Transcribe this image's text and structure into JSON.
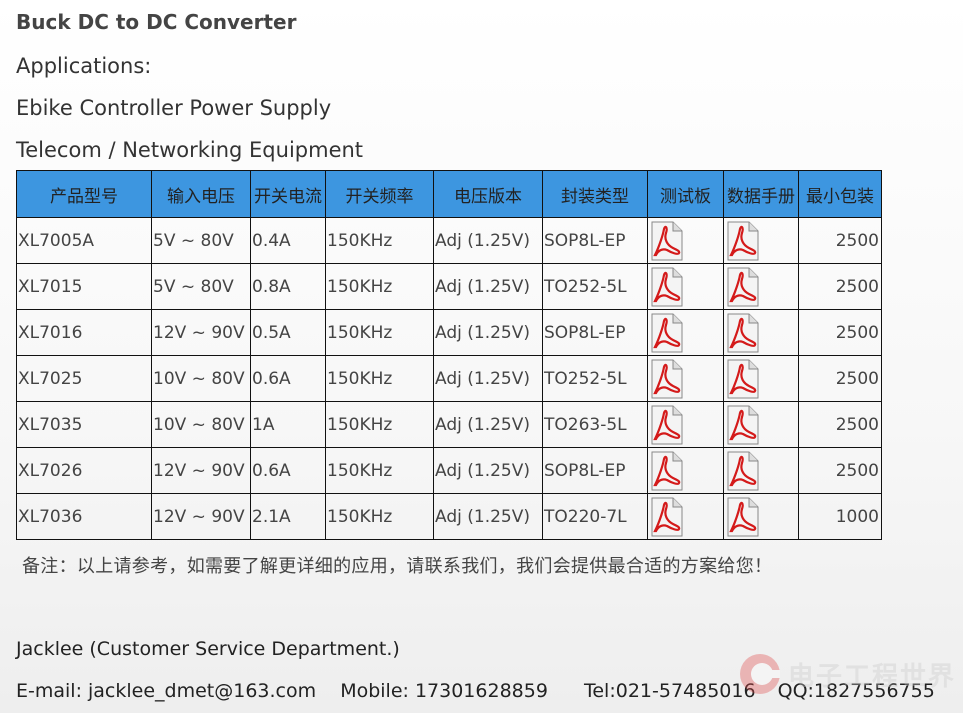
{
  "heading": "Buck DC to DC Converter",
  "applications_label": "Applications:",
  "applications": [
    "Ebike Controller Power Supply",
    "Telecom / Networking Equipment"
  ],
  "table": {
    "headers": [
      "产品型号",
      "输入电压",
      "开关电流",
      "开关频率",
      "电压版本",
      "封装类型",
      "测试板",
      "数据手册",
      "最小包装"
    ],
    "rows": [
      {
        "model": "XL7005A",
        "vin": "5V ~ 80V",
        "current": "0.4A",
        "freq": "150KHz",
        "version": "Adj (1.25V)",
        "package": "SOP8L-EP",
        "moq": "2500"
      },
      {
        "model": "XL7015",
        "vin": "5V ~ 80V",
        "current": "0.8A",
        "freq": "150KHz",
        "version": "Adj (1.25V)",
        "package": "TO252-5L",
        "moq": "2500"
      },
      {
        "model": "XL7016",
        "vin": "12V ~ 90V",
        "current": "0.5A",
        "freq": "150KHz",
        "version": "Adj (1.25V)",
        "package": "SOP8L-EP",
        "moq": "2500"
      },
      {
        "model": "XL7025",
        "vin": "10V ~ 80V",
        "current": "0.6A",
        "freq": "150KHz",
        "version": "Adj (1.25V)",
        "package": "TO252-5L",
        "moq": "2500"
      },
      {
        "model": "XL7035",
        "vin": "10V ~ 80V",
        "current": "1A",
        "freq": "150KHz",
        "version": "Adj (1.25V)",
        "package": "TO263-5L",
        "moq": "2500"
      },
      {
        "model": "XL7026",
        "vin": "12V ~ 90V",
        "current": "0.6A",
        "freq": "150KHz",
        "version": "Adj (1.25V)",
        "package": "SOP8L-EP",
        "moq": "2500"
      },
      {
        "model": "XL7036",
        "vin": "12V ~ 90V",
        "current": "2.1A",
        "freq": "150KHz",
        "version": "Adj (1.25V)",
        "package": "TO220-7L",
        "moq": "1000"
      }
    ],
    "header_color": "#3d96e0",
    "pdf_icon": "pdf-file-icon"
  },
  "note": "备注：以上请参考，如需要了解更详细的应用，请联系我们，我们会提供最合适的方案给您！",
  "contact": {
    "name": "Jacklee (Customer Service Department.)",
    "email": "E-mail: jacklee_dmet@163.com",
    "mobile": "Mobile: 17301628859",
    "tel": "Tel:021-57485016",
    "qq": "QQ:1827556755"
  },
  "watermark": "电子工程世界"
}
